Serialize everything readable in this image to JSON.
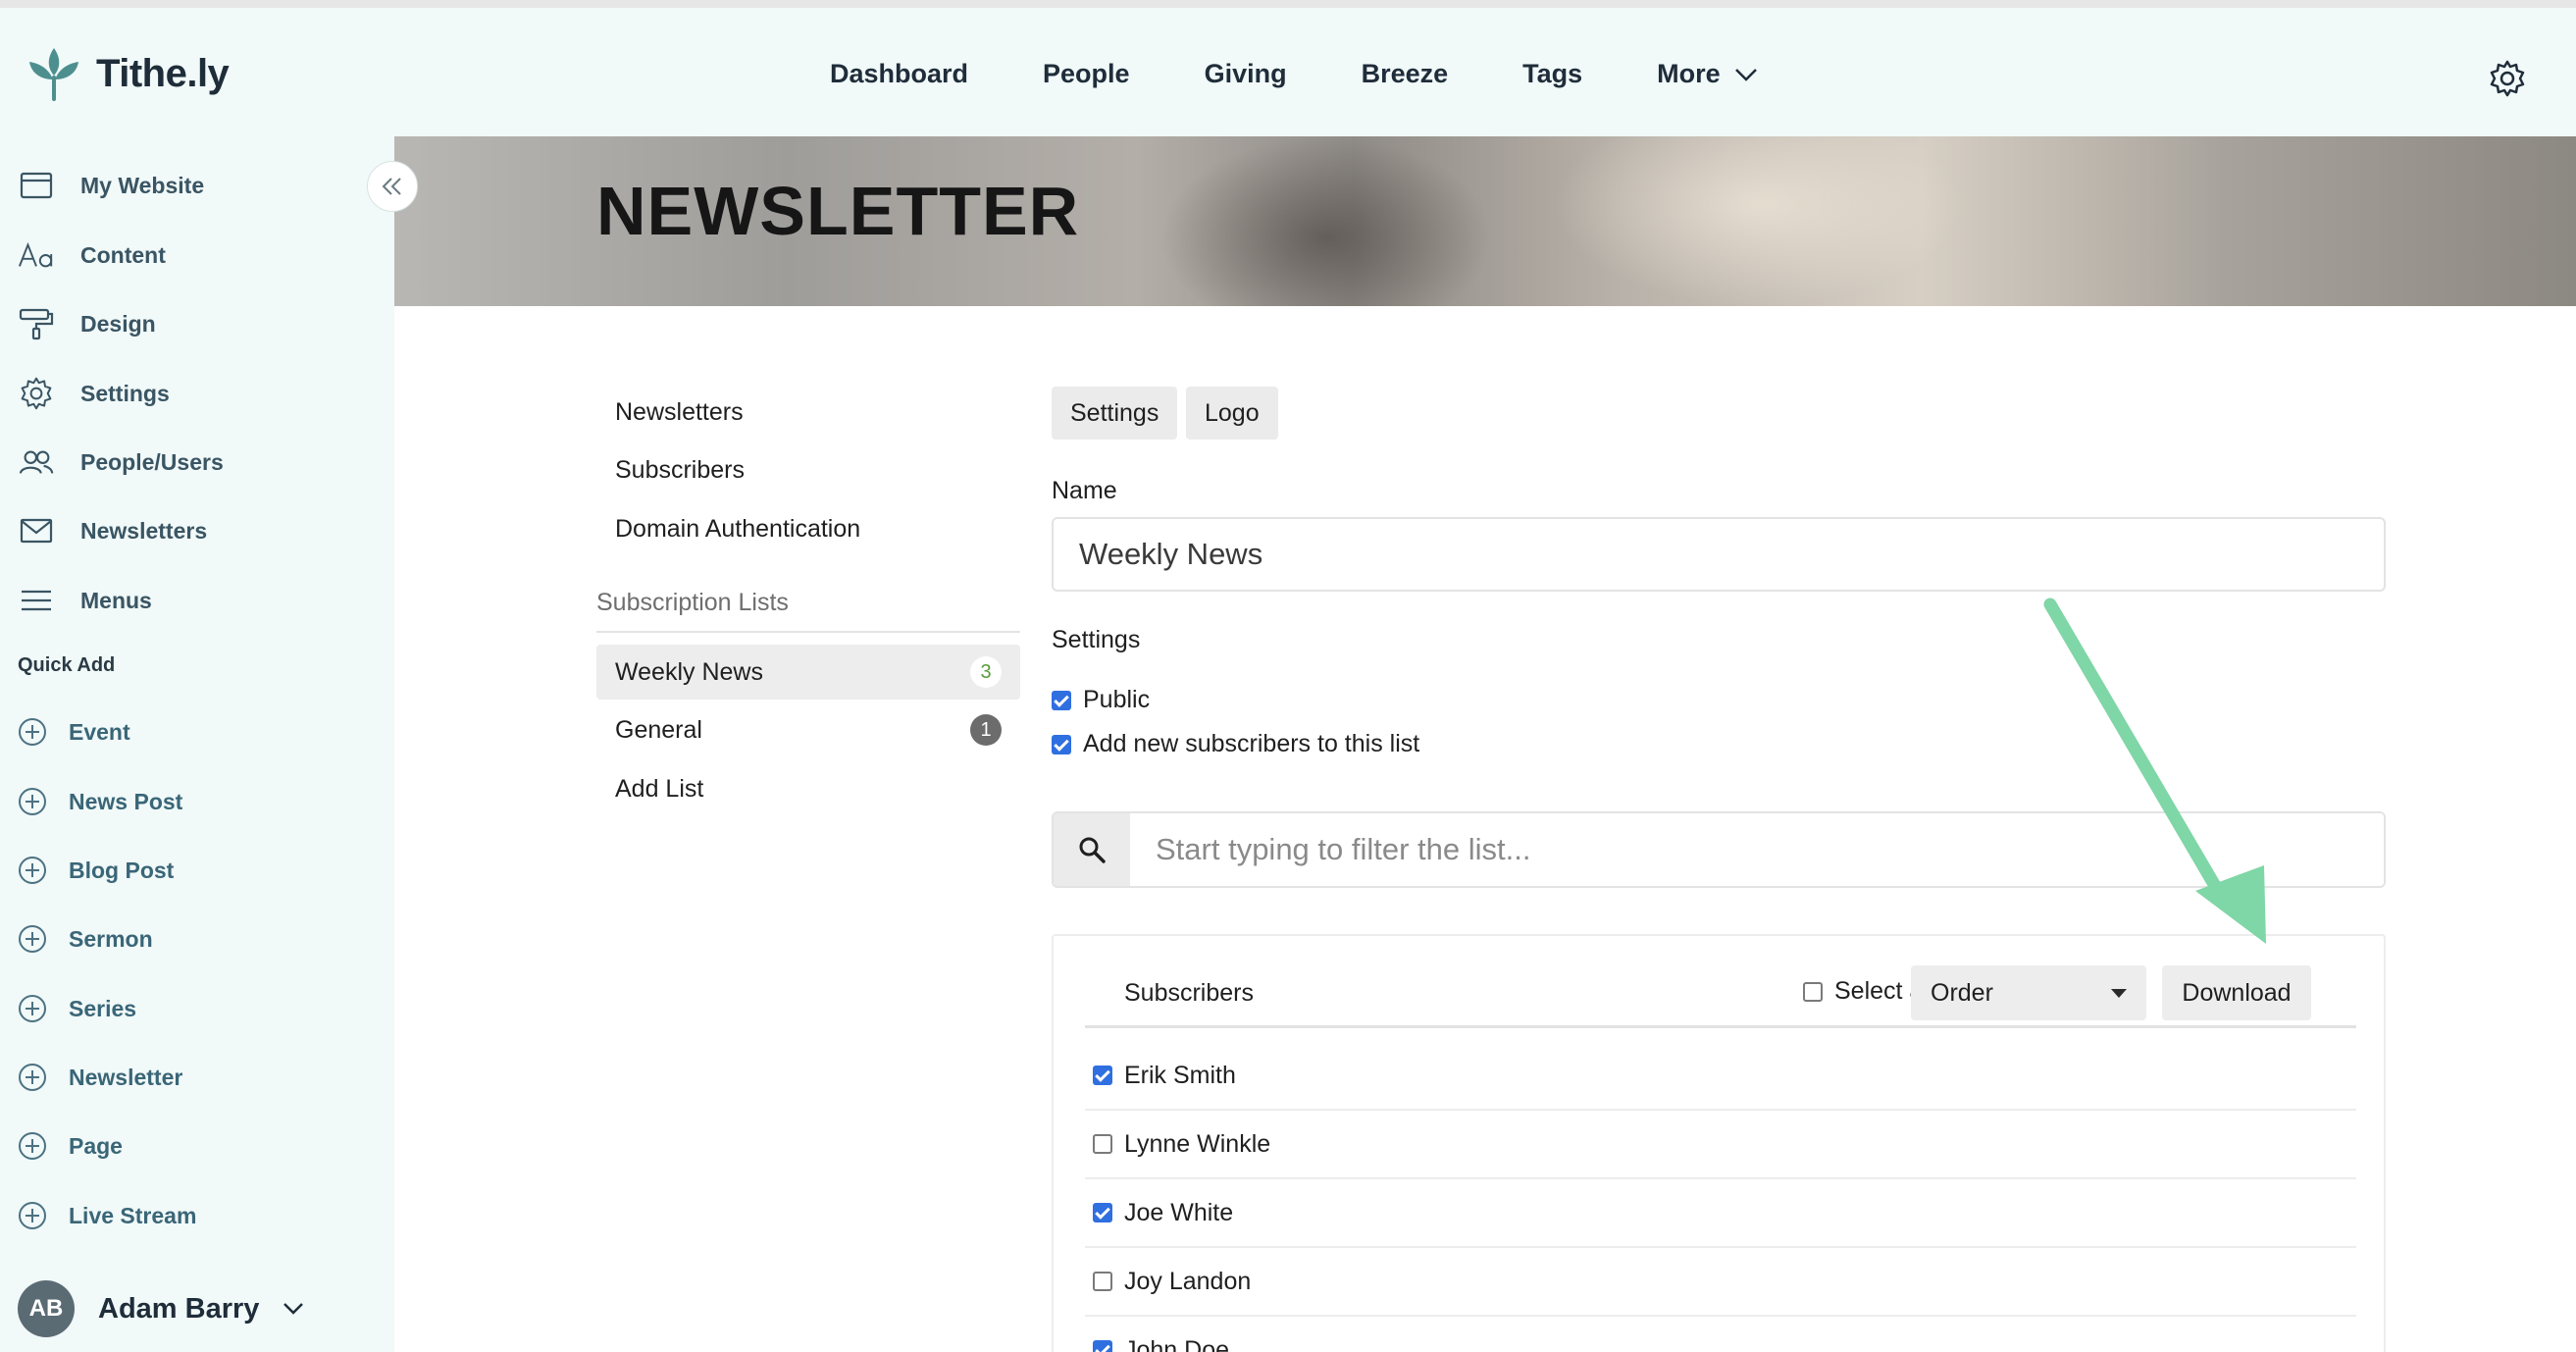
{
  "app": {
    "logo_text": "Tithe.ly"
  },
  "topnav": {
    "items": [
      "Dashboard",
      "People",
      "Giving",
      "Breeze",
      "Tags",
      "More"
    ]
  },
  "sidebar": {
    "items": [
      "My Website",
      "Content",
      "Design",
      "Settings",
      "People/Users",
      "Newsletters",
      "Menus"
    ],
    "quick_add_label": "Quick Add",
    "quick_add_items": [
      "Event",
      "News Post",
      "Blog Post",
      "Sermon",
      "Series",
      "Newsletter",
      "Page",
      "Live Stream"
    ],
    "user": {
      "initials": "AB",
      "name": "Adam Barry"
    }
  },
  "hero": {
    "title": "NEWSLETTER"
  },
  "content_nav": {
    "links": [
      "Newsletters",
      "Subscribers",
      "Domain Authentication"
    ],
    "section_title": "Subscription Lists",
    "lists": [
      {
        "label": "Weekly News",
        "count": "3"
      },
      {
        "label": "General",
        "count": "1"
      }
    ],
    "add_list": "Add List"
  },
  "form": {
    "tabs": [
      "Settings",
      "Logo"
    ],
    "name_label": "Name",
    "name_value": "Weekly News",
    "settings_label": "Settings",
    "checkbox_public": "Public",
    "checkbox_add_new": "Add new subscribers to this list",
    "search_placeholder": "Start typing to filter the list..."
  },
  "subscribers": {
    "title": "Subscribers",
    "select_all": "Select all",
    "order_label": "Order",
    "download_label": "Download",
    "rows": [
      {
        "name": "Erik Smith",
        "checked": true
      },
      {
        "name": "Lynne Winkle",
        "checked": false
      },
      {
        "name": "Joe White",
        "checked": true
      },
      {
        "name": "Joy Landon",
        "checked": false
      },
      {
        "name": "John Doe",
        "checked": true
      }
    ]
  },
  "colors": {
    "accent_arrow": "#7fd6a6",
    "checkbox_blue": "#2f6fe0",
    "sidebar_bg": "#f1f9f9"
  }
}
